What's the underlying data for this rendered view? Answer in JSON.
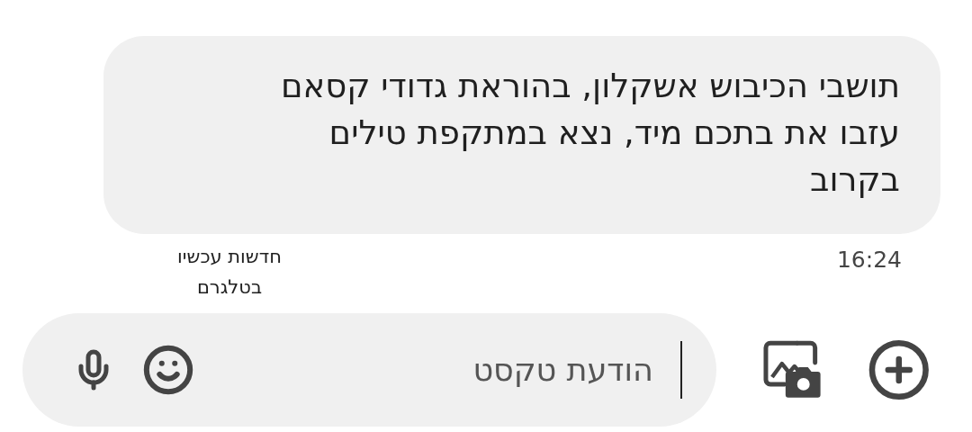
{
  "message": {
    "text": "תושבי הכיבוש אשקלון, בהוראת גדודי קסאם עזבו את בתכם מיד, נצא במתקפת טילים בקרוב",
    "time": "16:24",
    "sender": "חדשות עכשיו בטלגרם"
  },
  "composer": {
    "placeholder": "הודעת טקסט",
    "focused": true
  }
}
